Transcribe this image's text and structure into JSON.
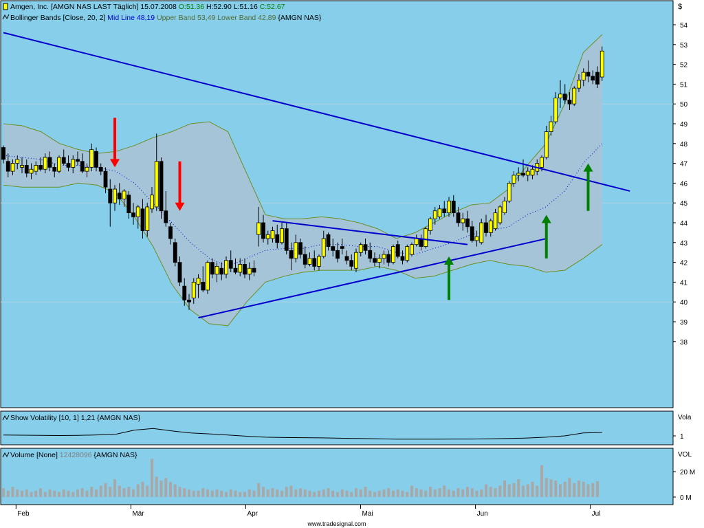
{
  "legend": {
    "main_prefix": "Amgen, Inc. [AMGN NAS LAST Täglich] 15.07.2008 ",
    "open": "O:51.36",
    "high": "H:52.90",
    "low": "L:51.16",
    "close": "C:52.67",
    "bb_prefix": "Bollinger Bands [Close, 20, 2] ",
    "bb_mid": "Mid Line 48,19",
    "bb_upper": "Upper Band 53,49",
    "bb_lower": "Lower Band 42,89",
    "bb_suffix": " {AMGN NAS}",
    "vola": "Show Volatility [10, 1] 1,21 {AMGN NAS}",
    "vol_prefix": "Volume [None] ",
    "vol_value": "12428096",
    "vol_suffix": " {AMGN NAS}"
  },
  "axis": {
    "currency": "$",
    "vola_label": "Vola",
    "vola_tick": "1",
    "vol_label": "VOL",
    "vol_ticks": [
      "20 M",
      "0 M"
    ],
    "months": [
      "Feb",
      "Mär",
      "Apr",
      "Mai",
      "Jun",
      "Jul"
    ]
  },
  "footer": "www.tradesignal.com",
  "colors": {
    "panel_bg": "#87ceeb",
    "band_fill": "#a6c4d8",
    "band_line": "#6b8e23",
    "trend_line": "#0000cd",
    "mid_line": "#0000cd",
    "candle_up": "#ffff00",
    "candle_down": "#000000",
    "volume_bar": "#a8a8a8",
    "arrow_red": "#ff0000",
    "arrow_green": "#008000"
  },
  "chart_data": {
    "type": "candlestick",
    "ylim": [
      37.5,
      55
    ],
    "yticks": [
      38,
      39,
      40,
      41,
      42,
      43,
      44,
      45,
      46,
      47,
      48,
      49,
      50,
      51,
      52,
      53,
      54
    ],
    "candles": [
      [
        47.8,
        47.9,
        47.0,
        47.2
      ],
      [
        47.1,
        47.5,
        46.3,
        46.6
      ],
      [
        46.6,
        47.2,
        46.4,
        47.0
      ],
      [
        47.0,
        47.4,
        46.7,
        47.2
      ],
      [
        46.8,
        47.3,
        46.5,
        46.9
      ],
      [
        46.9,
        47.2,
        46.3,
        46.5
      ],
      [
        46.5,
        47.0,
        46.2,
        46.7
      ],
      [
        46.6,
        47.1,
        46.4,
        46.9
      ],
      [
        46.9,
        47.3,
        46.6,
        46.7
      ],
      [
        46.7,
        47.5,
        46.5,
        47.3
      ],
      [
        47.3,
        47.6,
        46.6,
        46.8
      ],
      [
        46.8,
        47.0,
        46.3,
        46.6
      ],
      [
        46.6,
        47.4,
        46.5,
        47.3
      ],
      [
        47.3,
        47.7,
        46.9,
        47.0
      ],
      [
        47.0,
        47.4,
        46.6,
        46.8
      ],
      [
        46.8,
        47.4,
        46.5,
        47.2
      ],
      [
        47.2,
        47.6,
        46.9,
        47.1
      ],
      [
        47.1,
        47.5,
        46.5,
        46.6
      ],
      [
        46.6,
        47.0,
        46.3,
        46.8
      ],
      [
        46.8,
        48.0,
        46.6,
        47.7
      ],
      [
        47.6,
        47.8,
        46.6,
        46.8
      ],
      [
        46.8,
        47.0,
        46.4,
        46.6
      ],
      [
        46.6,
        46.8,
        45.5,
        45.8
      ],
      [
        45.7,
        46.2,
        43.8,
        45.0
      ],
      [
        45.0,
        45.9,
        44.6,
        45.7
      ],
      [
        45.5,
        46.0,
        44.9,
        45.2
      ],
      [
        45.2,
        45.7,
        44.8,
        45.6
      ],
      [
        45.4,
        45.6,
        44.2,
        44.5
      ],
      [
        44.5,
        45.0,
        43.9,
        44.3
      ],
      [
        44.3,
        44.9,
        43.7,
        44.8
      ],
      [
        44.7,
        45.2,
        43.2,
        43.6
      ],
      [
        43.6,
        45.0,
        43.3,
        44.8
      ],
      [
        44.7,
        45.8,
        44.5,
        45.4
      ],
      [
        44.8,
        48.5,
        44.6,
        47.1
      ],
      [
        47.1,
        47.3,
        44.2,
        44.6
      ],
      [
        44.6,
        45.6,
        43.8,
        44.0
      ],
      [
        43.8,
        44.0,
        42.9,
        43.2
      ],
      [
        43.0,
        43.2,
        41.8,
        42.0
      ],
      [
        42.0,
        42.3,
        40.8,
        41.0
      ],
      [
        40.8,
        41.2,
        39.8,
        40.1
      ],
      [
        40.1,
        40.4,
        39.6,
        40.0
      ],
      [
        40.2,
        41.2,
        39.9,
        41.0
      ],
      [
        40.9,
        41.4,
        40.2,
        41.2
      ],
      [
        41.0,
        41.8,
        40.5,
        40.6
      ],
      [
        40.6,
        42.1,
        40.4,
        42.0
      ],
      [
        42.0,
        42.2,
        41.2,
        41.4
      ],
      [
        41.4,
        42.0,
        41.0,
        41.8
      ],
      [
        41.7,
        42.0,
        41.1,
        41.4
      ],
      [
        41.4,
        42.3,
        41.2,
        42.1
      ],
      [
        42.1,
        42.6,
        41.5,
        41.7
      ],
      [
        41.7,
        42.2,
        41.4,
        41.5
      ],
      [
        41.5,
        42.2,
        41.3,
        41.9
      ],
      [
        41.9,
        42.2,
        41.2,
        41.4
      ],
      [
        41.4,
        42.0,
        41.1,
        41.7
      ],
      [
        41.7,
        42.1,
        41.3,
        41.5
      ],
      [
        43.4,
        44.8,
        42.8,
        44.0
      ],
      [
        44.0,
        44.4,
        43.0,
        43.2
      ],
      [
        43.2,
        43.6,
        42.9,
        43.4
      ],
      [
        43.2,
        43.8,
        43.0,
        43.6
      ],
      [
        43.4,
        43.9,
        42.7,
        43.0
      ],
      [
        43.0,
        44.0,
        42.9,
        43.7
      ],
      [
        43.7,
        44.0,
        42.4,
        42.6
      ],
      [
        42.6,
        43.0,
        41.6,
        42.2
      ],
      [
        42.2,
        43.4,
        42.0,
        43.0
      ],
      [
        43.0,
        43.2,
        42.2,
        42.4
      ],
      [
        42.4,
        42.8,
        41.7,
        41.9
      ],
      [
        41.9,
        42.5,
        41.8,
        42.2
      ],
      [
        42.2,
        42.6,
        41.6,
        41.8
      ],
      [
        41.8,
        42.4,
        41.6,
        42.3
      ],
      [
        42.3,
        43.6,
        42.2,
        43.2
      ],
      [
        43.4,
        43.5,
        42.6,
        42.8
      ],
      [
        42.8,
        43.2,
        42.3,
        42.6
      ],
      [
        42.6,
        43.0,
        42.0,
        42.2
      ],
      [
        42.8,
        43.2,
        42.4,
        42.7
      ],
      [
        42.3,
        42.6,
        41.9,
        42.1
      ],
      [
        42.1,
        42.4,
        41.6,
        41.8
      ],
      [
        41.7,
        42.7,
        41.5,
        42.5
      ],
      [
        42.5,
        43.0,
        42.3,
        42.9
      ],
      [
        42.9,
        43.2,
        42.4,
        42.6
      ],
      [
        42.6,
        43.0,
        42.0,
        42.2
      ],
      [
        42.2,
        42.5,
        41.8,
        42.0
      ],
      [
        42.0,
        42.4,
        41.7,
        42.2
      ],
      [
        42.2,
        42.6,
        41.9,
        42.4
      ],
      [
        42.4,
        42.6,
        41.8,
        42.0
      ],
      [
        42.0,
        42.9,
        41.9,
        42.8
      ],
      [
        42.9,
        43.1,
        42.2,
        42.3
      ],
      [
        42.3,
        42.6,
        41.9,
        42.1
      ],
      [
        42.1,
        42.9,
        42.0,
        42.8
      ],
      [
        42.4,
        43.0,
        42.3,
        42.9
      ],
      [
        42.9,
        43.4,
        42.8,
        43.2
      ],
      [
        43.2,
        43.4,
        42.6,
        42.8
      ],
      [
        42.8,
        43.8,
        42.7,
        43.7
      ],
      [
        43.6,
        44.3,
        43.4,
        44.2
      ],
      [
        44.2,
        44.8,
        43.9,
        44.6
      ],
      [
        44.3,
        44.9,
        44.2,
        44.7
      ],
      [
        44.7,
        45.1,
        44.3,
        44.5
      ],
      [
        44.5,
        45.3,
        44.3,
        45.1
      ],
      [
        45.1,
        45.4,
        44.3,
        44.5
      ],
      [
        44.5,
        44.8,
        43.8,
        44.0
      ],
      [
        44.0,
        44.5,
        43.6,
        44.2
      ],
      [
        44.2,
        44.6,
        43.5,
        43.8
      ],
      [
        43.8,
        44.1,
        43.0,
        43.1
      ],
      [
        43.1,
        43.6,
        42.8,
        43.3
      ],
      [
        43.0,
        44.2,
        42.9,
        44.0
      ],
      [
        44.0,
        44.4,
        43.3,
        43.5
      ],
      [
        43.5,
        44.2,
        43.3,
        44.1
      ],
      [
        43.7,
        44.7,
        43.6,
        44.5
      ],
      [
        44.0,
        44.9,
        43.9,
        44.8
      ],
      [
        44.5,
        45.3,
        44.4,
        45.1
      ],
      [
        45.1,
        46.1,
        45.0,
        46.0
      ],
      [
        46.0,
        46.6,
        45.8,
        46.4
      ],
      [
        46.4,
        46.8,
        46.1,
        46.5
      ],
      [
        46.5,
        47.2,
        46.3,
        46.4
      ],
      [
        46.4,
        46.8,
        46.1,
        46.6
      ],
      [
        46.4,
        46.9,
        46.2,
        46.7
      ],
      [
        46.6,
        47.2,
        46.4,
        47.0
      ],
      [
        46.8,
        47.4,
        46.6,
        47.3
      ],
      [
        47.3,
        48.9,
        47.2,
        48.6
      ],
      [
        48.6,
        49.4,
        48.4,
        49.1
      ],
      [
        49.1,
        50.6,
        49.0,
        50.3
      ],
      [
        50.3,
        51.2,
        49.8,
        50.5
      ],
      [
        50.5,
        51.0,
        50.0,
        50.2
      ],
      [
        50.2,
        50.6,
        49.7,
        50.0
      ],
      [
        50.0,
        50.9,
        49.9,
        50.8
      ],
      [
        50.8,
        51.5,
        50.6,
        51.2
      ],
      [
        51.2,
        51.8,
        50.9,
        51.6
      ],
      [
        51.6,
        52.2,
        51.1,
        51.4
      ],
      [
        51.4,
        51.7,
        51.0,
        51.2
      ],
      [
        51.6,
        51.9,
        50.8,
        51.0
      ],
      [
        51.36,
        52.9,
        51.16,
        52.67
      ]
    ],
    "upper_band": [
      49.0,
      48.9,
      48.6,
      48.0,
      47.7,
      47.5,
      47.6,
      47.9,
      48.3,
      48.6,
      49.0,
      49.1,
      48.6,
      46.5,
      44.4,
      44.2,
      44.2,
      44.3,
      44.2,
      44.0,
      43.7,
      43.2,
      43.5,
      44.0,
      44.5,
      44.9,
      45.0,
      45.7,
      46.9,
      48.0,
      50.0,
      52.6,
      53.5
    ],
    "lower_band": [
      45.9,
      45.8,
      45.8,
      45.8,
      46.0,
      45.9,
      45.5,
      44.3,
      42.8,
      40.9,
      39.6,
      38.9,
      38.8,
      40.0,
      41.0,
      41.3,
      41.5,
      41.6,
      41.6,
      41.6,
      41.8,
      41.6,
      41.2,
      41.3,
      41.6,
      41.9,
      42.1,
      41.9,
      41.8,
      41.5,
      41.6,
      42.2,
      42.9
    ],
    "mid_line": [
      47.4,
      47.3,
      47.2,
      46.9,
      46.9,
      46.8,
      46.6,
      46.0,
      45.0,
      44.0,
      43.0,
      42.2,
      41.8,
      42.2,
      42.6,
      42.7,
      42.7,
      42.9,
      42.9,
      42.8,
      42.8,
      42.5,
      42.4,
      42.7,
      43.0,
      43.4,
      43.6,
      43.8,
      44.4,
      44.8,
      45.6,
      47.0,
      48.0
    ],
    "volatility": [
      1.05,
      1.04,
      1.03,
      1.02,
      1.03,
      1.06,
      1.1,
      1.35,
      1.45,
      1.3,
      1.18,
      1.12,
      1.05,
      0.98,
      0.92,
      0.9,
      0.89,
      0.88,
      0.86,
      0.84,
      0.82,
      0.8,
      0.8,
      0.8,
      0.81,
      0.81,
      0.82,
      0.84,
      0.87,
      0.92,
      1.0,
      1.18,
      1.21
    ],
    "volume": [
      7,
      5,
      8,
      6,
      5,
      6,
      4,
      5,
      7,
      4,
      6,
      5,
      4,
      6,
      5,
      4,
      6,
      7,
      5,
      8,
      6,
      9,
      11,
      8,
      14,
      9,
      7,
      8,
      6,
      10,
      12,
      9,
      30,
      16,
      13,
      15,
      12,
      10,
      8,
      7,
      6,
      5,
      5,
      7,
      6,
      5,
      6,
      5,
      4,
      6,
      5,
      4,
      4,
      6,
      5,
      11,
      8,
      6,
      7,
      6,
      5,
      8,
      9,
      6,
      7,
      6,
      5,
      4,
      5,
      6,
      7,
      5,
      4,
      6,
      5,
      4,
      7,
      6,
      8,
      5,
      4,
      5,
      6,
      7,
      5,
      6,
      5,
      4,
      9,
      7,
      6,
      5,
      8,
      6,
      7,
      9,
      6,
      5,
      7,
      6,
      8,
      7,
      5,
      6,
      10,
      8,
      7,
      9,
      13,
      10,
      11,
      14,
      9,
      10,
      12,
      9,
      25,
      15,
      14,
      13,
      10,
      12,
      15,
      11,
      13,
      12,
      10,
      11,
      12.4
    ],
    "trendlines": [
      {
        "from": [
          0,
          53.6
        ],
        "to": [
          135,
          45.6
        ]
      },
      {
        "from": [
          42,
          39.2
        ],
        "to": [
          117,
          43.2
        ]
      },
      {
        "from": [
          58,
          44.1
        ],
        "to": [
          100,
          42.9
        ]
      }
    ],
    "arrows": [
      {
        "color": "red",
        "x": 24,
        "from": 49.3,
        "to": 46.8
      },
      {
        "color": "red",
        "x": 38,
        "from": 47.1,
        "to": 44.6
      },
      {
        "color": "green",
        "x": 96,
        "from": 40.1,
        "to": 42.3
      },
      {
        "color": "green",
        "x": 117,
        "from": 42.2,
        "to": 44.4
      },
      {
        "color": "green",
        "x": 126,
        "from": 44.6,
        "to": 47.0
      }
    ],
    "month_positions": [
      0.5,
      25.5,
      50.5,
      75.5,
      100.5,
      125.5
    ]
  }
}
